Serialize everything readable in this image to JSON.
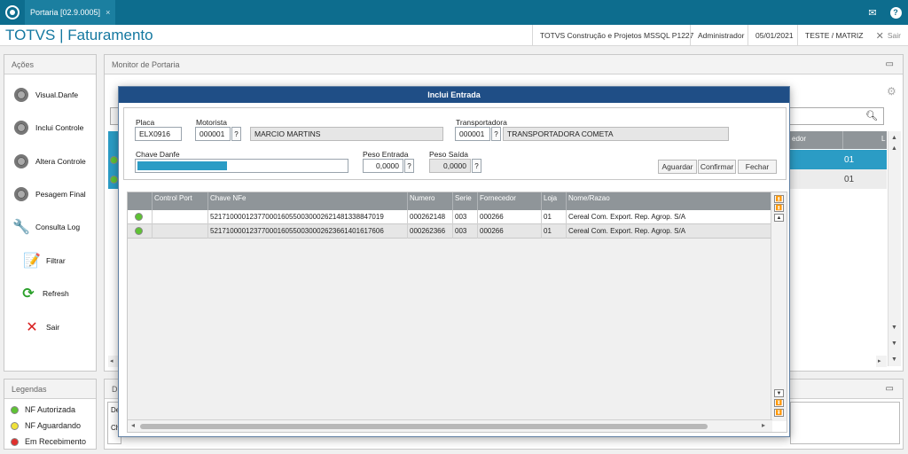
{
  "topbar": {
    "tab_label": "Portaria [02.9.0005]",
    "tab_close": "×",
    "mail_icon": "envelope-icon",
    "help_icon": "question-icon"
  },
  "titlebar": {
    "title": "TOTVS | Faturamento",
    "company": "TOTVS Construção e Projetos MSSQL P1227",
    "user": "Administrador",
    "date": "05/01/2021",
    "branch": "TESTE / MATRIZ",
    "exit_label": "Sair",
    "exit_icon": "✕"
  },
  "actions": {
    "header": "Ações",
    "items": [
      {
        "label": "Visual.Danfe",
        "icon": "gear-icon"
      },
      {
        "label": "Inclui Controle",
        "icon": "gear-icon"
      },
      {
        "label": "Altera Controle",
        "icon": "gear-icon"
      },
      {
        "label": "Pesagem Final",
        "icon": "gear-icon"
      },
      {
        "label": "Consulta Log",
        "icon": "tools-icon"
      },
      {
        "label": "Filtrar",
        "icon": "filter-icon"
      },
      {
        "label": "Refresh",
        "icon": "refresh-icon"
      },
      {
        "label": "Sair",
        "icon": "close-icon"
      }
    ]
  },
  "legends": {
    "header": "Legendas",
    "items": [
      {
        "label": "NF Autorizada",
        "color": "#5ec234"
      },
      {
        "label": "NF Aguardando",
        "color": "#f0e23a"
      },
      {
        "label": "Em Recebimento",
        "color": "#e0302e"
      }
    ]
  },
  "monitor": {
    "header": "Monitor de Portaria",
    "bg_col_fornecedor": "edor",
    "bg_col_loja": "L",
    "bg_row1_loja": "01",
    "bg_row2_loja": "01",
    "bottom_panel_label": "D",
    "bottom_text1": "De",
    "bottom_text2": "Ch"
  },
  "modal": {
    "title": "Inclui Entrada",
    "placa": {
      "label": "Placa",
      "value": "ELX0916"
    },
    "motorista": {
      "label": "Motorista",
      "code": "000001",
      "name": "MARCIO MARTINS"
    },
    "transportadora": {
      "label": "Transportadora",
      "code": "000001",
      "name": "TRANSPORTADORA COMETA"
    },
    "chave_danfe": {
      "label": "Chave Danfe",
      "fill_fraction": 0.43
    },
    "peso_entrada": {
      "label": "Peso Entrada",
      "value": "0,0000"
    },
    "peso_saida": {
      "label": "Peso Saída",
      "value": "0,0000"
    },
    "lookup": "?",
    "buttons": {
      "aguardar": "Aguardar",
      "confirmar": "Confirmar",
      "fechar": "Fechar"
    },
    "grid": {
      "columns": [
        "",
        "Control Port",
        "Chave NFe",
        "Numero",
        "Serie",
        "Fornecedor",
        "Loja",
        "Nome/Razao"
      ],
      "rows": [
        {
          "status": "#5ec234",
          "control": "",
          "chave": "52171000012377000160550030002621481338847019",
          "numero": "000262148",
          "serie": "003",
          "fornecedor": "000266",
          "loja": "01",
          "nome": "Cereal Com. Export. Rep. Agrop. S/A"
        },
        {
          "status": "#5ec234",
          "control": "",
          "chave": "52171000012377000160550030002623661401617606",
          "numero": "000262366",
          "serie": "003",
          "fornecedor": "000266",
          "loja": "01",
          "nome": "Cereal Com. Export. Rep. Agrop. S/A"
        }
      ]
    }
  }
}
